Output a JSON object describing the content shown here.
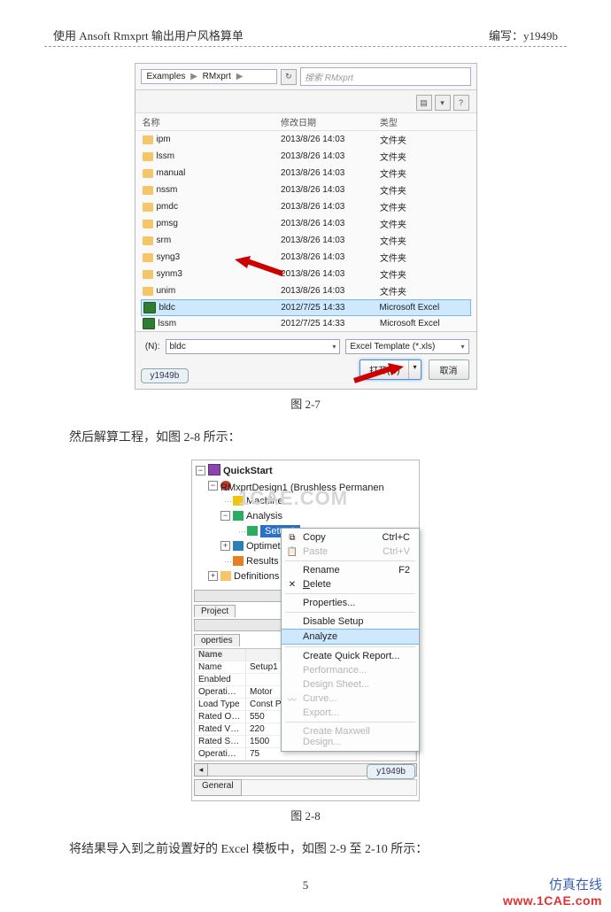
{
  "header": {
    "title": "使用 Ansoft Rmxprt 输出用户风格算单",
    "author_prefix": "编写：",
    "author": "y1949b"
  },
  "fig27": {
    "breadcrumb": {
      "a": "Examples",
      "b": "RMxprt"
    },
    "search_placeholder": "搜索 RMxprt",
    "columns": {
      "name": "名称",
      "date": "修改日期",
      "type": "类型"
    },
    "rows": [
      {
        "icon": "folder",
        "name": "ipm",
        "date": "2013/8/26 14:03",
        "type": "文件夹"
      },
      {
        "icon": "folder",
        "name": "lssm",
        "date": "2013/8/26 14:03",
        "type": "文件夹"
      },
      {
        "icon": "folder",
        "name": "manual",
        "date": "2013/8/26 14:03",
        "type": "文件夹"
      },
      {
        "icon": "folder",
        "name": "nssm",
        "date": "2013/8/26 14:03",
        "type": "文件夹"
      },
      {
        "icon": "folder",
        "name": "pmdc",
        "date": "2013/8/26 14:03",
        "type": "文件夹"
      },
      {
        "icon": "folder",
        "name": "pmsg",
        "date": "2013/8/26 14:03",
        "type": "文件夹"
      },
      {
        "icon": "folder",
        "name": "srm",
        "date": "2013/8/26 14:03",
        "type": "文件夹"
      },
      {
        "icon": "folder",
        "name": "syng3",
        "date": "2013/8/26 14:03",
        "type": "文件夹"
      },
      {
        "icon": "folder",
        "name": "synm3",
        "date": "2013/8/26 14:03",
        "type": "文件夹"
      },
      {
        "icon": "folder",
        "name": "unim",
        "date": "2013/8/26 14:03",
        "type": "文件夹"
      },
      {
        "icon": "excel",
        "name": "bldc",
        "date": "2012/7/25 14:33",
        "type": "Microsoft Excel",
        "selected": true
      },
      {
        "icon": "excel",
        "name": "lssm",
        "date": "2012/7/25 14:33",
        "type": "Microsoft Excel"
      }
    ],
    "filename_label": "(N):",
    "filename_value": "bldc",
    "filter_value": "Excel Template (*.xls)",
    "open_label": "打开(O)",
    "cancel_label": "取消",
    "watermark": "y1949b"
  },
  "caption27": "图 2-7",
  "para1": "然后解算工程，如图 2-8 所示：",
  "fig28": {
    "tree": {
      "root": "QuickStart",
      "design": "RMxprtDesign1 (Brushless Permanen",
      "machine": "Machine",
      "analysis": "Analysis",
      "setup": "Setup1",
      "optimetrics": "Optimetrics",
      "results": "Results",
      "definitions": "Definitions"
    },
    "ctx": {
      "copy": "Copy",
      "copy_k": "Ctrl+C",
      "paste": "Paste",
      "paste_k": "Ctrl+V",
      "rename": "Rename",
      "rename_k": "F2",
      "delete": "Delete",
      "properties": "Properties...",
      "disable": "Disable Setup",
      "analyze": "Analyze",
      "quick": "Create Quick Report...",
      "performance": "Performance...",
      "sheet": "Design Sheet...",
      "curve": "Curve...",
      "export": "Export...",
      "maxwell": "Create Maxwell Design..."
    },
    "tab_project": "Project",
    "tab_properties": "operties",
    "prop_hdr_name": "Name",
    "prop_hdr_value": "",
    "props": [
      {
        "n": "Name",
        "v": "Setup1"
      },
      {
        "n": "Enabled",
        "v": ""
      },
      {
        "n": "Operati…",
        "v": "Motor"
      },
      {
        "n": "Load Type",
        "v": "Const Power"
      },
      {
        "n": "Rated O…",
        "v": "550"
      },
      {
        "n": "Rated V…",
        "v": "220"
      },
      {
        "n": "Rated S…",
        "v": "1500"
      },
      {
        "n": "Operati…",
        "v": "75"
      }
    ],
    "bottom_tab": "General",
    "watermark": "y1949b",
    "wm_site": "1CAE.COM"
  },
  "caption28": "图 2-8",
  "para2": "将结果导入到之前设置好的 Excel 模板中，如图 2-9 至 2-10 所示：",
  "page_number": "5",
  "site": {
    "cn": "仿真在线",
    "en": "www.1CAE.com"
  }
}
